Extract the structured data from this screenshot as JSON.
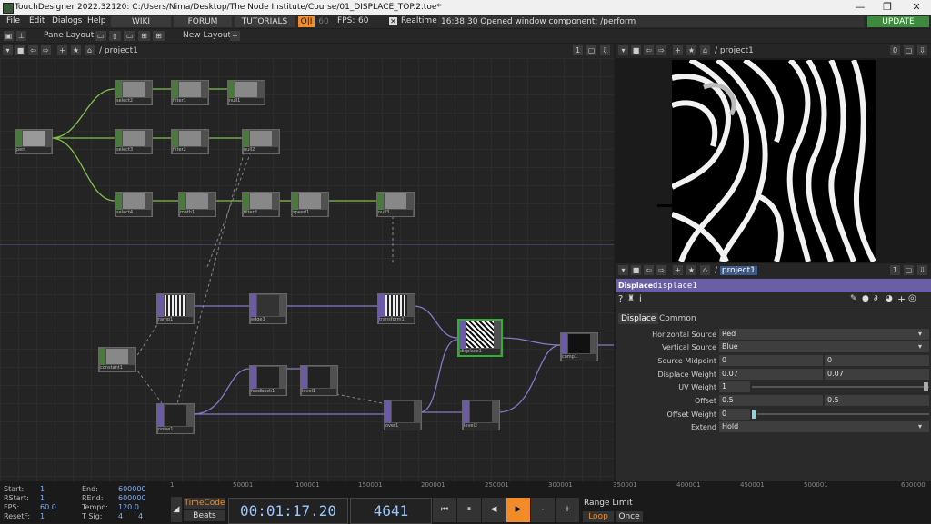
{
  "window": {
    "title": "TouchDesigner 2022.32120: C:/Users/Nima/Desktop/The Node Institute/Course/01_DISPLACE_TOP.2.toe*",
    "minimize": "—",
    "maximize": "❐",
    "close": "✕"
  },
  "menu": {
    "items": [
      "File",
      "Edit",
      "Dialogs",
      "Help"
    ],
    "wiki": "WIKI",
    "forum": "FORUM",
    "tutorials": "TUTORIALS",
    "oi": "O|I",
    "fps_cap": "60",
    "fps_label": "FPS:",
    "fps_value": "60",
    "realtime": "Realtime",
    "status": "16:38:30 Opened window component: /perform",
    "update": "UPDATE"
  },
  "toolbar": {
    "pane_layout": "Pane Layout",
    "new_layout": "New Layout",
    "plus": "+"
  },
  "network_pane": {
    "path": "/ project1",
    "num": "1"
  },
  "viewer_pane": {
    "path": "/ project1",
    "num": "0"
  },
  "param_pane": {
    "path": "project1",
    "num": "1"
  },
  "nodes": [
    {
      "label": "peri"
    },
    {
      "label": "select2"
    },
    {
      "label": "filter1"
    },
    {
      "label": "null1"
    },
    {
      "label": "select3"
    },
    {
      "label": "filter2"
    },
    {
      "label": "null2"
    },
    {
      "label": "select4"
    },
    {
      "label": "math1"
    },
    {
      "label": "filter3"
    },
    {
      "label": "speed1"
    },
    {
      "label": "null3"
    },
    {
      "label": "ramp1"
    },
    {
      "label": "edge1"
    },
    {
      "label": "transform1"
    },
    {
      "label": "constant1"
    },
    {
      "label": "displace1"
    },
    {
      "label": "comp1"
    },
    {
      "label": "feedback1"
    },
    {
      "label": "level1"
    },
    {
      "label": "noise1"
    },
    {
      "label": "over1"
    },
    {
      "label": "level2"
    }
  ],
  "params": {
    "op_type": "Displace",
    "op_name": "displace1",
    "tabs": [
      "Displace",
      "Common"
    ],
    "rows": [
      {
        "label": "Horizontal Source",
        "value": "Red",
        "dropdown": true
      },
      {
        "label": "Vertical Source",
        "value": "Blue",
        "dropdown": true
      },
      {
        "label": "Source Midpoint",
        "v1": "0",
        "v2": "0"
      },
      {
        "label": "Displace Weight",
        "v1": "0.07",
        "v2": "0.07"
      },
      {
        "label": "UV Weight",
        "value": "1",
        "slider": 1
      },
      {
        "label": "Offset",
        "v1": "0.5",
        "v2": "0.5"
      },
      {
        "label": "Offset Weight",
        "value": "0",
        "slider": 0
      },
      {
        "label": "Extend",
        "value": "Hold",
        "dropdown": true
      }
    ]
  },
  "ruler": [
    "1",
    "50001",
    "100001",
    "150001",
    "200001",
    "250001",
    "300001",
    "350001",
    "400001",
    "450001",
    "500001",
    "600000"
  ],
  "timeline": {
    "labels": {
      "start": "Start:",
      "rstart": "RStart:",
      "fps": "FPS:",
      "resetf": "ResetF:",
      "end": "End:",
      "rend": "REnd:",
      "tempo": "Tempo:",
      "tsig": "T Sig:"
    },
    "start": "1",
    "rstart": "1",
    "fps": "60.0",
    "resetf": "1",
    "end": "600000",
    "rend": "600000",
    "tempo": "120.0",
    "tsig1": "4",
    "tsig2": "4",
    "timecode_btn": "TimeCode",
    "beats_btn": "Beats",
    "timecode": "00:01:17.20",
    "frame": "4641",
    "range_limit": "Range Limit",
    "loop": "Loop",
    "once": "Once",
    "controls": [
      "⏮",
      "⏸",
      "◀",
      "▶",
      "-",
      "+"
    ]
  },
  "colors": {
    "accent": "#f28c28",
    "selected": "#2fb12f",
    "chop": "#4a7a3a",
    "top": "#6c5aa8",
    "param_header": "#6a5fa6"
  }
}
